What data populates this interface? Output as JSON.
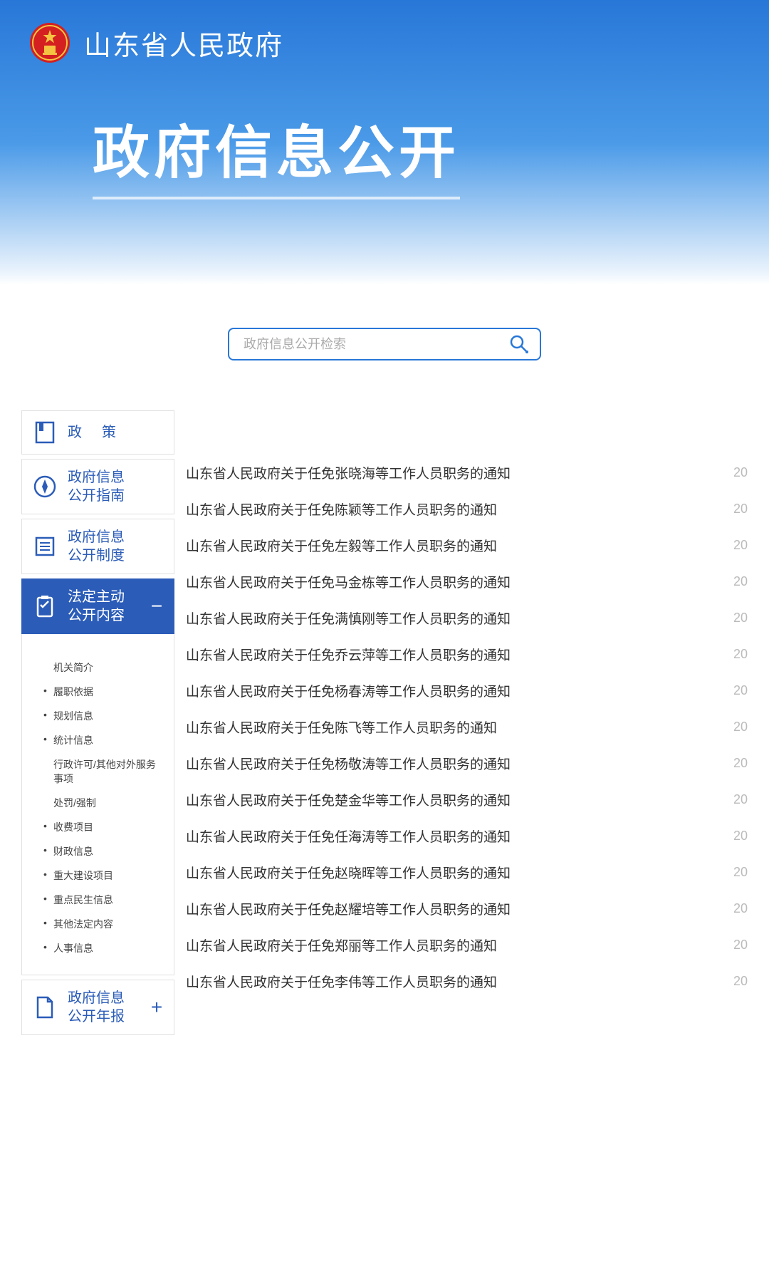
{
  "site": {
    "name": "山东省人民政府",
    "hero_title": "政府信息公开"
  },
  "search": {
    "placeholder": "政府信息公开检索"
  },
  "sidebar": {
    "items": [
      {
        "id": "policy",
        "label": "政策",
        "icon": "doc-bookmark"
      },
      {
        "id": "guide",
        "label": "政府信息\n公开指南",
        "icon": "compass"
      },
      {
        "id": "system",
        "label": "政府信息\n公开制度",
        "icon": "list-doc"
      },
      {
        "id": "statutory",
        "label": "法定主动\n公开内容",
        "icon": "clipboard",
        "active": true,
        "toggle": "−"
      },
      {
        "id": "annual",
        "label": "政府信息\n公开年报",
        "icon": "doc-fold",
        "toggle": "+"
      }
    ],
    "sub_items": [
      {
        "label": "机关简介",
        "dotted": false
      },
      {
        "label": "履职依据",
        "dotted": true
      },
      {
        "label": "规划信息",
        "dotted": true
      },
      {
        "label": "统计信息",
        "dotted": true
      },
      {
        "label": "行政许可/其他对外服务事项",
        "dotted": false
      },
      {
        "label": "处罚/强制",
        "dotted": false
      },
      {
        "label": "收费项目",
        "dotted": true
      },
      {
        "label": "财政信息",
        "dotted": true
      },
      {
        "label": "重大建设项目",
        "dotted": true
      },
      {
        "label": "重点民生信息",
        "dotted": true
      },
      {
        "label": "其他法定内容",
        "dotted": true
      },
      {
        "label": "人事信息",
        "dotted": true
      }
    ]
  },
  "notices": [
    {
      "title": "山东省人民政府关于任免张晓海等工作人员职务的通知",
      "date": "20"
    },
    {
      "title": "山东省人民政府关于任免陈颖等工作人员职务的通知",
      "date": "20"
    },
    {
      "title": "山东省人民政府关于任免左毅等工作人员职务的通知",
      "date": "20"
    },
    {
      "title": "山东省人民政府关于任免马金栋等工作人员职务的通知",
      "date": "20"
    },
    {
      "title": "山东省人民政府关于任免满慎刚等工作人员职务的通知",
      "date": "20"
    },
    {
      "title": "山东省人民政府关于任免乔云萍等工作人员职务的通知",
      "date": "20"
    },
    {
      "title": "山东省人民政府关于任免杨春涛等工作人员职务的通知",
      "date": "20"
    },
    {
      "title": "山东省人民政府关于任免陈飞等工作人员职务的通知",
      "date": "20"
    },
    {
      "title": "山东省人民政府关于任免杨敬涛等工作人员职务的通知",
      "date": "20"
    },
    {
      "title": "山东省人民政府关于任免楚金华等工作人员职务的通知",
      "date": "20"
    },
    {
      "title": "山东省人民政府关于任免任海涛等工作人员职务的通知",
      "date": "20"
    },
    {
      "title": "山东省人民政府关于任免赵晓晖等工作人员职务的通知",
      "date": "20"
    },
    {
      "title": "山东省人民政府关于任免赵耀培等工作人员职务的通知",
      "date": "20"
    },
    {
      "title": "山东省人民政府关于任免郑丽等工作人员职务的通知",
      "date": "20"
    },
    {
      "title": "山东省人民政府关于任免李伟等工作人员职务的通知",
      "date": "20"
    }
  ]
}
